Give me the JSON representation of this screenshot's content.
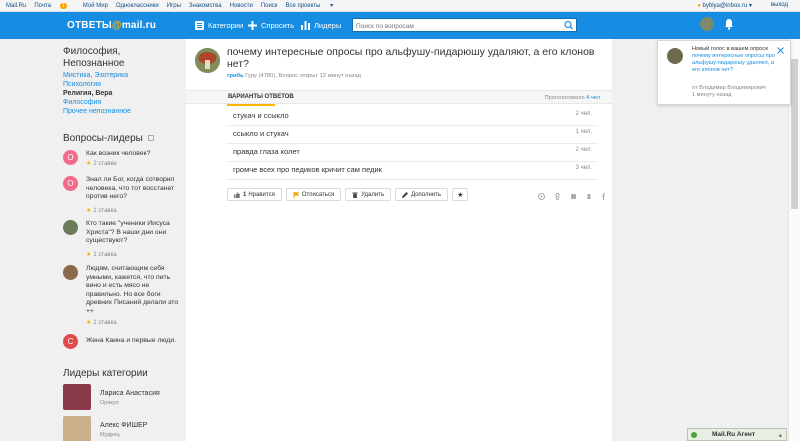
{
  "portal": {
    "links": [
      "Mail.Ru",
      "Почта",
      "Мой Мир",
      "Одноклассники",
      "Игры",
      "Знакомства",
      "Новости",
      "Поиск",
      "Все проекты"
    ],
    "mail_badge": "1",
    "user_email": "byblya@inbox.ru",
    "logout": "выход"
  },
  "header": {
    "logo_main": "ОТВЕТЫ",
    "logo_at": "@",
    "logo_suffix": "mail.ru",
    "nav_categories": "Категории",
    "nav_ask": "Спросить",
    "nav_leaders": "Лидеры",
    "search_placeholder": "Поиск по вопросам"
  },
  "sidebar": {
    "category_title": "Философия, Непознанное",
    "categories": [
      {
        "label": "Мистика, Эзотерика",
        "active": false
      },
      {
        "label": "Психология",
        "active": false
      },
      {
        "label": "Религия, Вера",
        "active": true
      },
      {
        "label": "Философия",
        "active": false
      },
      {
        "label": "Прочее непознанное",
        "active": false
      }
    ],
    "leader_questions_title": "Вопросы-лидеры",
    "leader_questions": [
      {
        "avatar": "О",
        "color": "#f06b8a",
        "text": "Как возник человек?",
        "rating": "2 ставки"
      },
      {
        "avatar": "О",
        "color": "#f06b8a",
        "text": "Знал ли Бог, когда сотворил человека, что тот восстанет против него?",
        "rating": "1 ставка"
      },
      {
        "avatar": "",
        "color": "#6b7a5a",
        "text": "Кто такие \"ученики Иисуса Христа\"? В наши дни они существуют?",
        "rating": "1 ставка"
      },
      {
        "avatar": "",
        "color": "#8a6a4a",
        "text": "Людям, считающим себя умными, кажется, что пить вино и есть мясо не правильно. Но все боги древних Писаний делали это ++",
        "rating": "1 ставка"
      },
      {
        "avatar": "C",
        "color": "#e04a4a",
        "text": "Жена Каина и первые люди.",
        "rating": ""
      }
    ],
    "category_leaders_title": "Лидеры категории",
    "category_leaders": [
      {
        "name": "Лариса Анастасия",
        "rank": "Оракул",
        "color": "#8a3a4a"
      },
      {
        "name": "Алекс ФИШЕР",
        "rank": "Мудрец",
        "color": "#c9b08a"
      }
    ]
  },
  "question": {
    "title": "почему интересные опросы про альфушу-пидарюшу удаляют, а его клонов нет?",
    "author": "грибь",
    "meta": "Гуру (4780), Вопрос открыт 12 минут назад",
    "variants_label": "ВАРИАНТЫ ОТВЕТОВ",
    "voted_label": "Проголосовало",
    "voted_count": "4 чел",
    "options": [
      {
        "text": "стукач и ссыкло",
        "count": "2 чел."
      },
      {
        "text": "ссыкло и стукач",
        "count": "1 чел."
      },
      {
        "text": "правда глаза колет",
        "count": "2 чел."
      },
      {
        "text": "громче всех про педиков кричит сам педик",
        "count": "3 чел."
      }
    ],
    "like_count": "1",
    "like_label": "Нравится",
    "subscribe_label": "Отписаться",
    "delete_label": "Удалить",
    "add_label": "Дополнить"
  },
  "notification": {
    "prefix": "Новый голос в вашем опросе",
    "link": "почему интересные опросы про альфушу-пидарюшу удаляют, а его клонов нет?",
    "from": "от Владимир Владимирович",
    "time": "1 минуту назад"
  },
  "agent": {
    "label": "Mail.Ru Агент"
  },
  "colors": {
    "brand_blue": "#168de2",
    "accent_orange": "#ffb400"
  }
}
